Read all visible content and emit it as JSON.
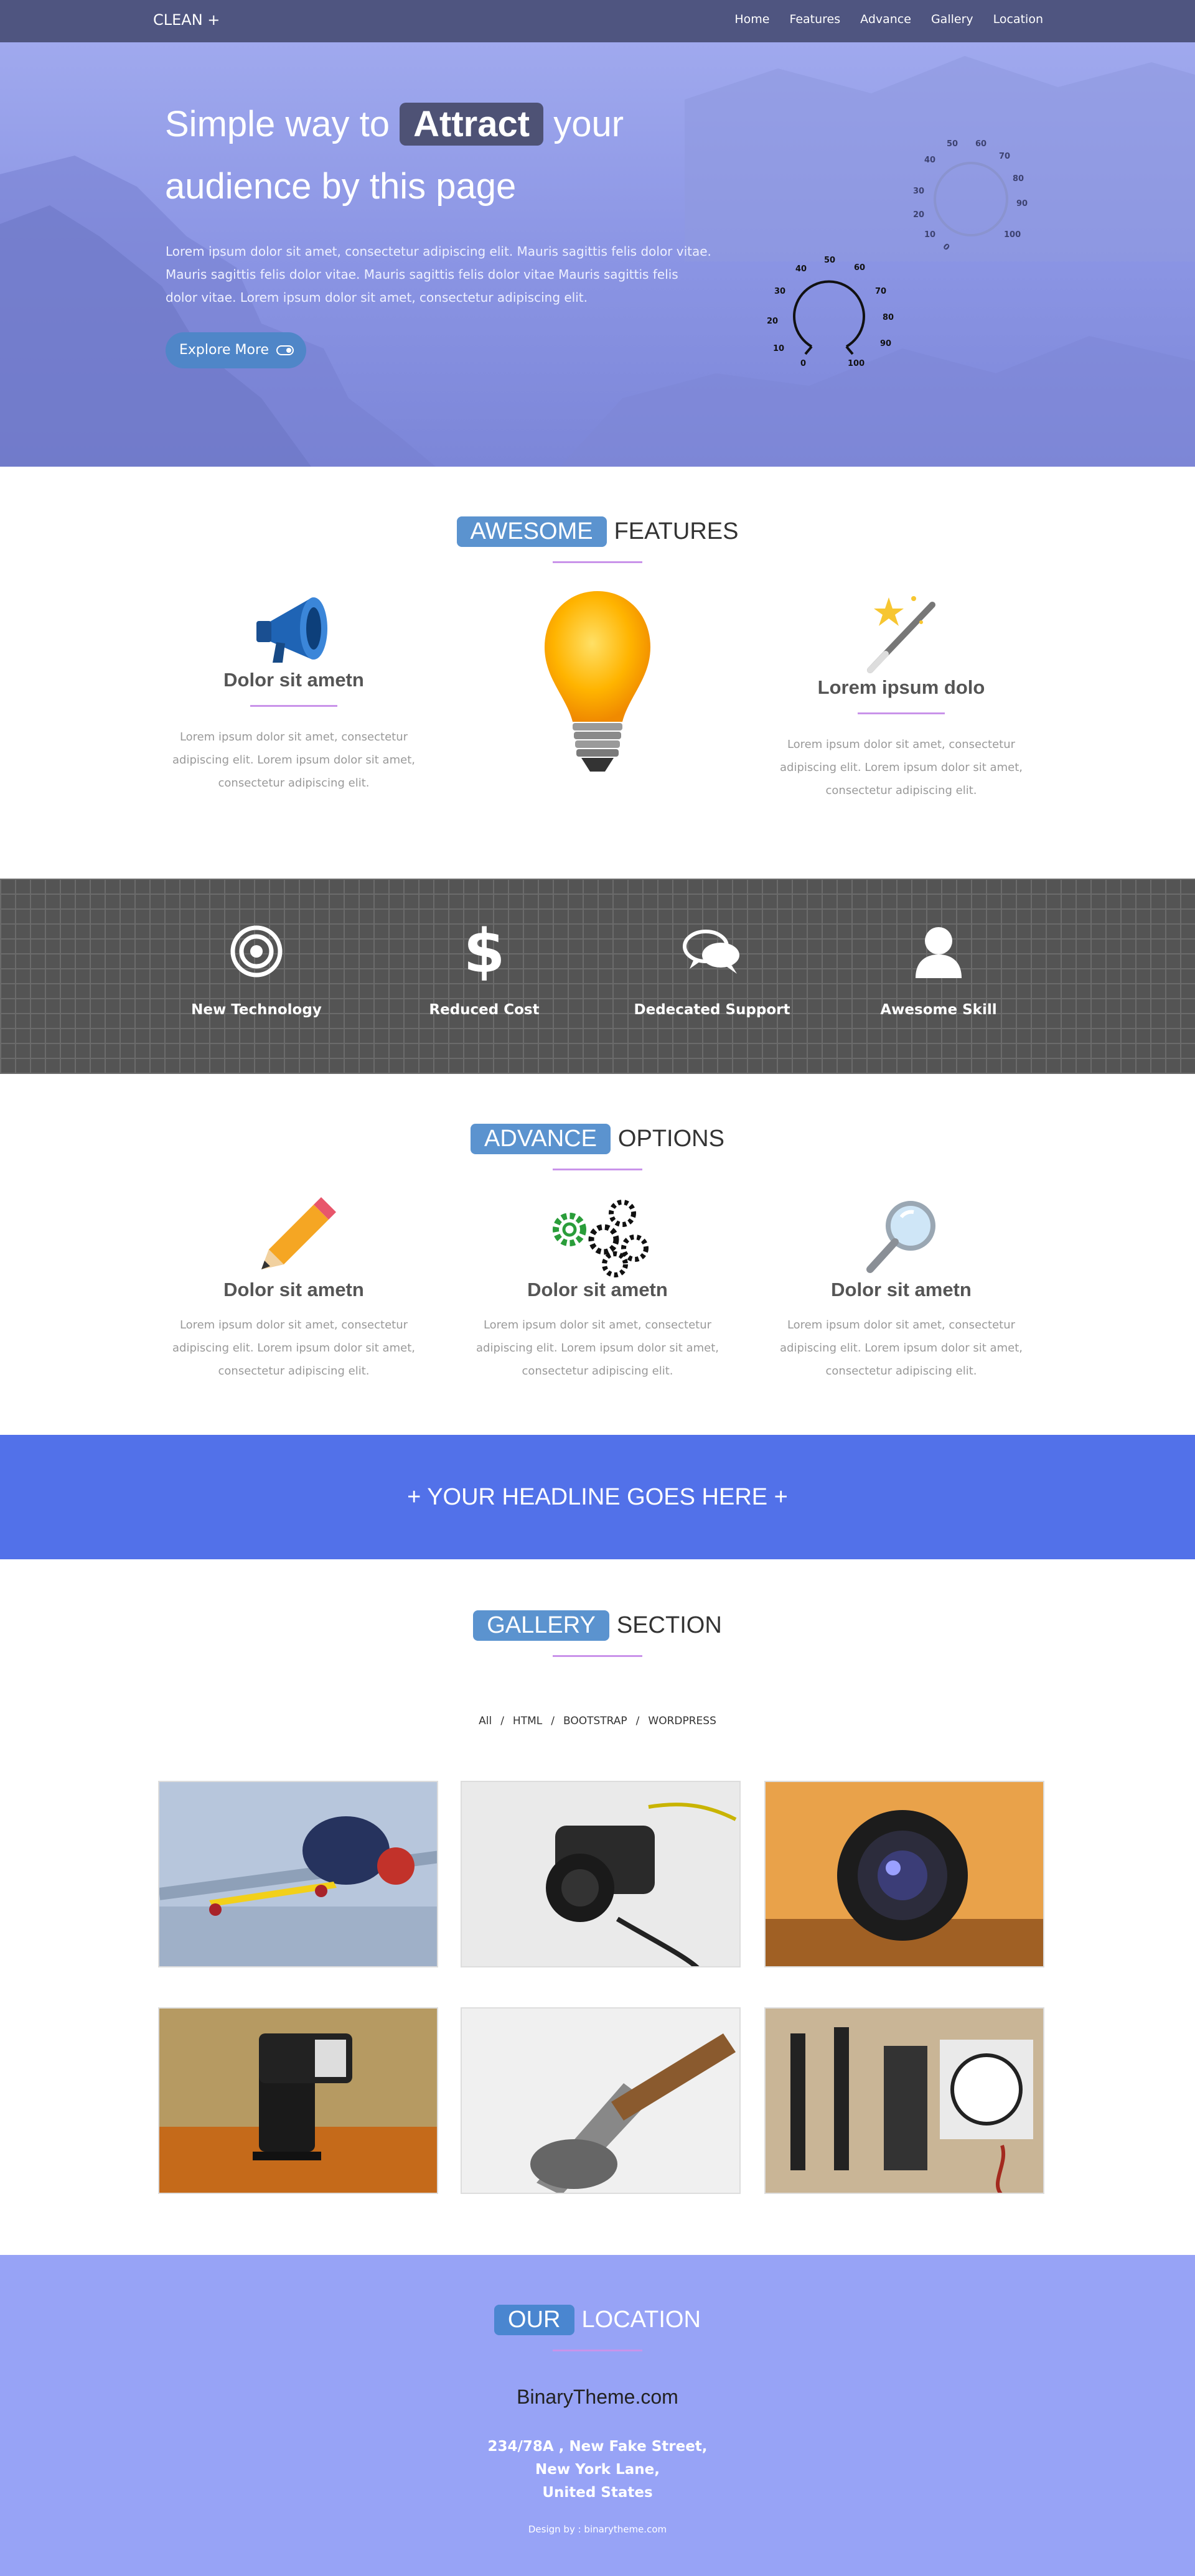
{
  "nav": {
    "brand": "CLEAN +",
    "items": [
      "Home",
      "Features",
      "Advance",
      "Gallery",
      "Location"
    ]
  },
  "hero": {
    "title_pre": "Simple way to",
    "title_highlight": "Attract",
    "title_post": "your",
    "title_line2": "audience by this page",
    "text": "Lorem ipsum dolor sit amet, consectetur adipiscing elit. Mauris sagittis felis dolor vitae. Mauris sagittis felis dolor vitae. Mauris sagittis felis dolor vitae Mauris sagittis felis dolor vitae. Lorem ipsum dolor sit amet, consectetur adipiscing elit.",
    "button_label": "Explore More",
    "dial_numbers": [
      "0",
      "10",
      "20",
      "30",
      "40",
      "50",
      "60",
      "70",
      "80",
      "90",
      "100"
    ]
  },
  "features": {
    "badge": "AWESOME",
    "rest": "FEATURES",
    "items": [
      {
        "title": "Dolor sit ametn",
        "text": "Lorem ipsum dolor sit amet, consectetur adipiscing elit. Lorem ipsum dolor sit amet, consectetur adipiscing elit.",
        "icon": "megaphone-icon"
      },
      {
        "icon": "lightbulb-icon"
      },
      {
        "title": "Lorem ipsum dolo",
        "text": "Lorem ipsum dolor sit amet, consectetur adipiscing elit. Lorem ipsum dolor sit amet, consectetur adipiscing elit.",
        "icon": "magic-wand-icon"
      }
    ]
  },
  "highlights": [
    {
      "label": "New Technology",
      "icon": "target-icon"
    },
    {
      "label": "Reduced Cost",
      "icon": "dollar-icon"
    },
    {
      "label": "Dedecated Support",
      "icon": "chat-bubbles-icon"
    },
    {
      "label": "Awesome Skill",
      "icon": "user-icon"
    }
  ],
  "advance": {
    "badge": "ADVANCE",
    "rest": "OPTIONS",
    "items": [
      {
        "title": "Dolor sit ametn",
        "text": "Lorem ipsum dolor sit amet, consectetur adipiscing elit. Lorem ipsum dolor sit amet, consectetur adipiscing elit.",
        "icon": "pencil-icon"
      },
      {
        "title": "Dolor sit ametn",
        "text": "Lorem ipsum dolor sit amet, consectetur adipiscing elit. Lorem ipsum dolor sit amet, consectetur adipiscing elit.",
        "icon": "gears-icon"
      },
      {
        "title": "Dolor sit ametn",
        "text": "Lorem ipsum dolor sit amet, consectetur adipiscing elit. Lorem ipsum dolor sit amet, consectetur adipiscing elit.",
        "icon": "magnifier-icon"
      }
    ]
  },
  "headline": "+ YOUR HEADLINE GOES HERE +",
  "gallery": {
    "badge": "GALLERY",
    "rest": "SECTION",
    "filters": [
      "All",
      "HTML",
      "BOOTSTRAP",
      "WORDPRESS"
    ],
    "separator": "/",
    "images": [
      "skateboard-helmet",
      "dslr-camera",
      "camera-lens",
      "camera-flash",
      "hammer",
      "medical-instruments"
    ]
  },
  "location": {
    "badge": "OUR",
    "rest": "LOCATION",
    "name": "BinaryTheme.com",
    "address": [
      "234/78A , New Fake Street,",
      "New York Lane,",
      "United States"
    ],
    "credit": "Design by : binarytheme.com"
  },
  "colors": {
    "nav": "#4f5580",
    "badge_blue": "#5b93cf",
    "accent_line": "#c993ea",
    "band": "#5271e9",
    "location_bg": "#97a3f6"
  }
}
